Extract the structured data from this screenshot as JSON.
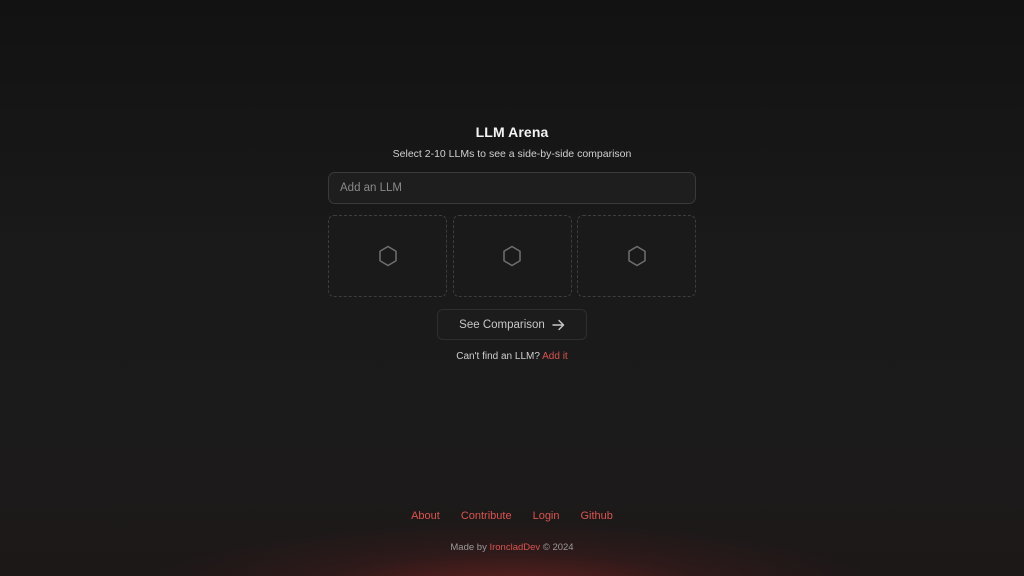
{
  "header": {
    "title": "LLM Arena",
    "subtitle": "Select 2-10 LLMs to see a side-by-side comparison"
  },
  "search": {
    "placeholder": "Add an LLM",
    "value": ""
  },
  "slots": [
    {
      "icon": "hexagon-icon"
    },
    {
      "icon": "hexagon-icon"
    },
    {
      "icon": "hexagon-icon"
    }
  ],
  "compare_button": {
    "label": "See Comparison",
    "icon": "arrow-right-icon"
  },
  "hint": {
    "text": "Can't find an LLM?",
    "link": "Add it"
  },
  "footer": {
    "links": [
      "About",
      "Contribute",
      "Login",
      "Github"
    ],
    "made_by_prefix": "Made by",
    "author": "IroncladDev",
    "suffix": "© 2024"
  },
  "colors": {
    "accent": "#d9534f",
    "background": "#141414"
  }
}
